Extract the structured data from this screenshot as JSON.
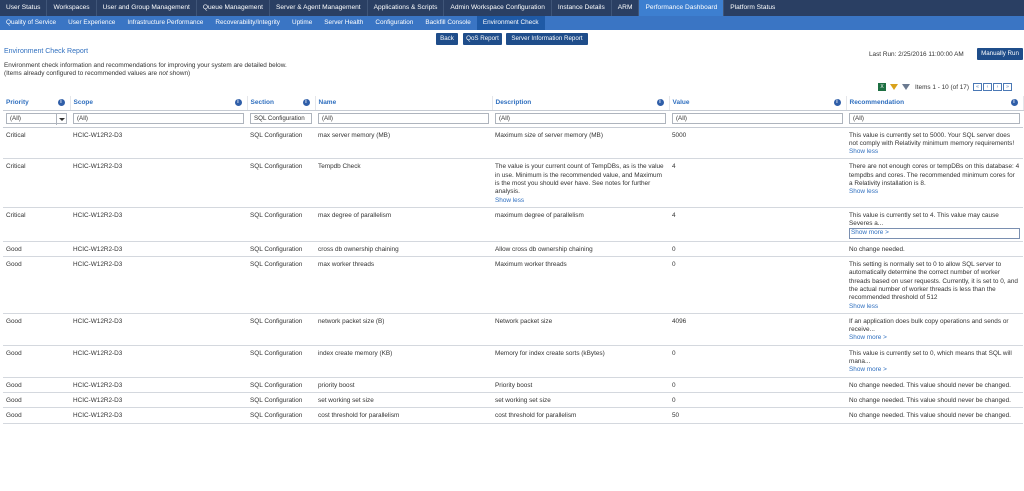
{
  "top_nav": [
    {
      "label": "User Status",
      "active": false
    },
    {
      "label": "Workspaces",
      "active": false
    },
    {
      "label": "User and Group Management",
      "active": false
    },
    {
      "label": "Queue Management",
      "active": false
    },
    {
      "label": "Server & Agent Management",
      "active": false
    },
    {
      "label": "Applications & Scripts",
      "active": false
    },
    {
      "label": "Admin Workspace Configuration",
      "active": false
    },
    {
      "label": "Instance Details",
      "active": false
    },
    {
      "label": "ARM",
      "active": false
    },
    {
      "label": "Performance Dashboard",
      "active": true
    },
    {
      "label": "Platform Status",
      "active": false
    }
  ],
  "sub_nav": [
    {
      "label": "Quality of Service",
      "active": false
    },
    {
      "label": "User Experience",
      "active": false
    },
    {
      "label": "Infrastructure Performance",
      "active": false
    },
    {
      "label": "Recoverability/Integrity",
      "active": false
    },
    {
      "label": "Uptime",
      "active": false
    },
    {
      "label": "Server Health",
      "active": false
    },
    {
      "label": "Configuration",
      "active": false
    },
    {
      "label": "Backfill Console",
      "active": false
    },
    {
      "label": "Environment Check",
      "active": true
    }
  ],
  "buttons": {
    "back": "Back",
    "qos": "QoS Report",
    "server_info": "Server Information Report",
    "manual": "Manually Run"
  },
  "report": {
    "title": "Environment Check Report",
    "intro_line1": "Environment check information and recommendations for improving your system are detailed below.",
    "intro_line2": "(Items already configured to recommended values are not shown)",
    "last_run": "Last Run: 2/25/2016 11:00:00 AM"
  },
  "pager": {
    "count": "Items 1 - 10 (of 17)",
    "first": "«",
    "prev": "‹",
    "next": "›",
    "last": "»",
    "excel_icon": "excel-icon",
    "filter_icon": "filter-icon",
    "clear_filter_icon": "clear-filter-icon"
  },
  "columns": [
    "Priority",
    "Scope",
    "Section",
    "Name",
    "Description",
    "Value",
    "Recommendation"
  ],
  "filters": {
    "priority": "(All)",
    "scope": "(All)",
    "section": "SQL Configuration",
    "name": "(All)",
    "description": "(All)",
    "value": "(All)",
    "recommendation": "(All)"
  },
  "rows": [
    {
      "priority": "Critical",
      "scope": "HCIC-W12R2-D3",
      "section": "SQL Configuration",
      "name": "max server memory (MB)",
      "description": "Maximum size of server memory (MB)",
      "desc_link": "",
      "value": "5000",
      "recommendation": "This value is currently set to 5000. Your SQL server does not comply with Relativity minimum memory requirements!",
      "rec_link": "Show less",
      "rec_link_boxed": false
    },
    {
      "priority": "Critical",
      "scope": "HCIC-W12R2-D3",
      "section": "SQL Configuration",
      "name": "Tempdb Check",
      "description": "The value is your current count of TempDBs, as is the value in use. Minimum is the recommended value, and Maximum is the most you should ever have. See notes for further analysis.",
      "desc_link": "Show less",
      "value": "4",
      "recommendation": "There are not enough cores or tempDBs on this database: 4 tempdbs and cores. The recommended minimum cores for a Relativity installation is 8.",
      "rec_link": "Show less",
      "rec_link_boxed": false
    },
    {
      "priority": "Critical",
      "scope": "HCIC-W12R2-D3",
      "section": "SQL Configuration",
      "name": "max degree of parallelism",
      "description": "maximum degree of parallelism",
      "desc_link": "",
      "value": "4",
      "recommendation": "This value is currently set to 4. This value may cause Severes a...",
      "rec_link": "Show more >",
      "rec_link_boxed": true
    },
    {
      "priority": "Good",
      "scope": "HCIC-W12R2-D3",
      "section": "SQL Configuration",
      "name": "cross db ownership chaining",
      "description": "Allow cross db ownership chaining",
      "desc_link": "",
      "value": "0",
      "recommendation": "No change needed.",
      "rec_link": "",
      "rec_link_boxed": false
    },
    {
      "priority": "Good",
      "scope": "HCIC-W12R2-D3",
      "section": "SQL Configuration",
      "name": "max worker threads",
      "description": "Maximum worker threads",
      "desc_link": "",
      "value": "0",
      "recommendation": "This setting is normally set to 0 to allow SQL server to automatically determine the correct number of worker threads based on user requests. Currently, it is set to 0, and the actual number of worker threads is less than the recommended threshold of 512",
      "rec_link": "Show less",
      "rec_link_boxed": false
    },
    {
      "priority": "Good",
      "scope": "HCIC-W12R2-D3",
      "section": "SQL Configuration",
      "name": "network packet size (B)",
      "description": "Network packet size",
      "desc_link": "",
      "value": "4096",
      "recommendation": "If an application does bulk copy operations and sends or receive...",
      "rec_link": "Show more >",
      "rec_link_boxed": false
    },
    {
      "priority": "Good",
      "scope": "HCIC-W12R2-D3",
      "section": "SQL Configuration",
      "name": "index create memory (KB)",
      "description": "Memory for index create sorts (kBytes)",
      "desc_link": "",
      "value": "0",
      "recommendation": "This value is currently set to 0, which means that SQL will mana...",
      "rec_link": "Show more >",
      "rec_link_boxed": false
    },
    {
      "priority": "Good",
      "scope": "HCIC-W12R2-D3",
      "section": "SQL Configuration",
      "name": "priority boost",
      "description": "Priority boost",
      "desc_link": "",
      "value": "0",
      "recommendation": "No change needed. This value should never be changed.",
      "rec_link": "",
      "rec_link_boxed": false
    },
    {
      "priority": "Good",
      "scope": "HCIC-W12R2-D3",
      "section": "SQL Configuration",
      "name": "set working set size",
      "description": "set working set size",
      "desc_link": "",
      "value": "0",
      "recommendation": "No change needed. This value should never be changed.",
      "rec_link": "",
      "rec_link_boxed": false
    },
    {
      "priority": "Good",
      "scope": "HCIC-W12R2-D3",
      "section": "SQL Configuration",
      "name": "cost threshold for parallelism",
      "description": "cost threshold for parallelism",
      "desc_link": "",
      "value": "50",
      "recommendation": "No change needed. This value should never be changed.",
      "rec_link": "",
      "rec_link_boxed": false
    }
  ]
}
